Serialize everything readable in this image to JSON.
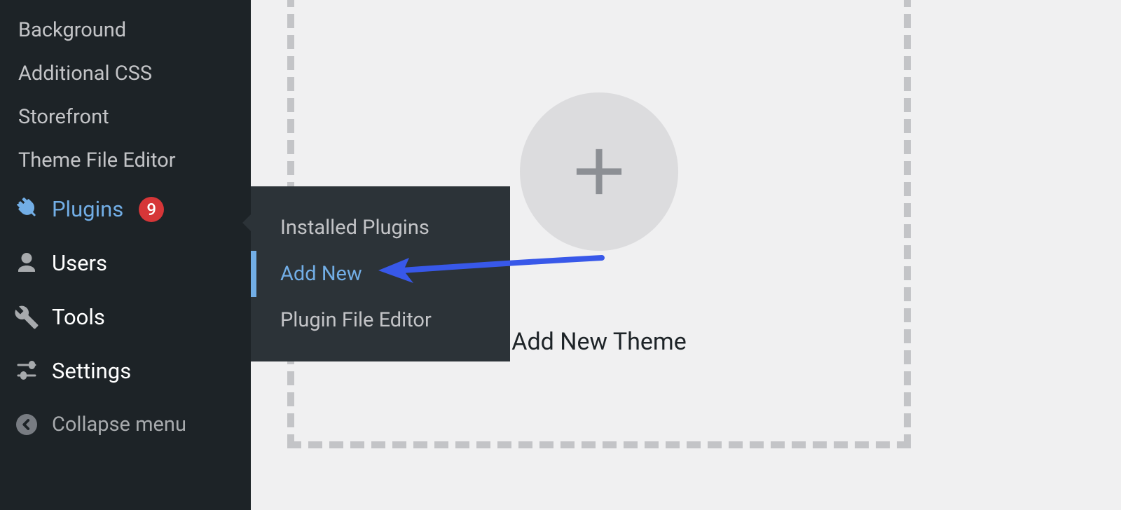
{
  "sidebar": {
    "sub_items": [
      {
        "label": "Background"
      },
      {
        "label": "Additional CSS"
      },
      {
        "label": "Storefront"
      },
      {
        "label": "Theme File Editor"
      }
    ],
    "main_items": [
      {
        "label": "Plugins",
        "icon": "plugin-icon",
        "badge": "9",
        "active": true
      },
      {
        "label": "Users",
        "icon": "users-icon"
      },
      {
        "label": "Tools",
        "icon": "tools-icon"
      },
      {
        "label": "Settings",
        "icon": "settings-icon"
      }
    ],
    "collapse_label": "Collapse menu"
  },
  "flyout": {
    "items": [
      {
        "label": "Installed Plugins",
        "highlighted": false
      },
      {
        "label": "Add New",
        "highlighted": true
      },
      {
        "label": "Plugin File Editor",
        "highlighted": false
      }
    ]
  },
  "content": {
    "add_theme_label": "Add New Theme"
  },
  "colors": {
    "accent": "#72aee6",
    "badge": "#d63638",
    "arrow": "#3858e9"
  }
}
